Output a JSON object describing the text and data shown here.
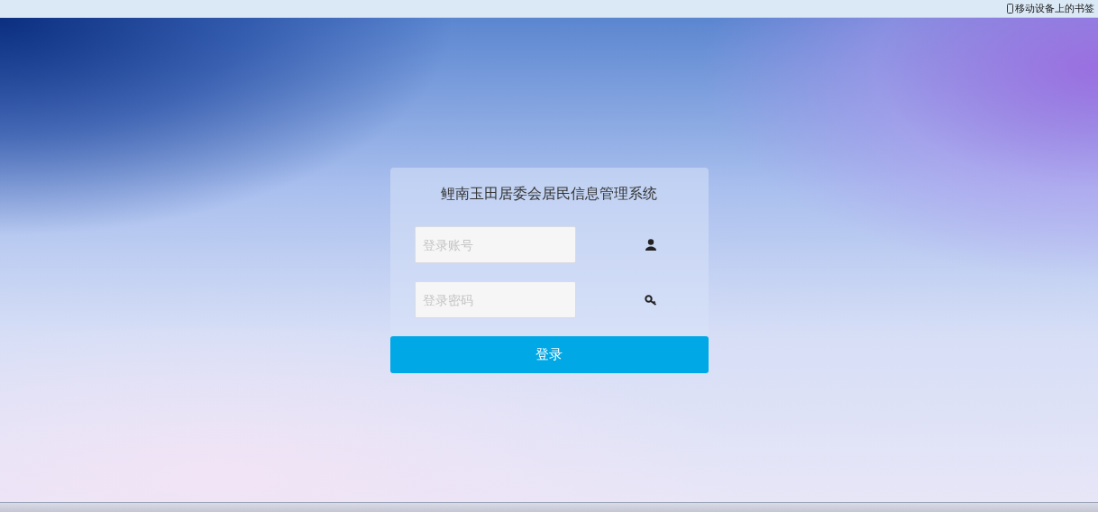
{
  "bookmarks_bar": {
    "mobile_bookmarks": "移动设备上的书签"
  },
  "login": {
    "title": "鲤南玉田居委会居民信息管理系统",
    "fields": [
      {
        "kind": "user",
        "placeholder": "登录账号"
      },
      {
        "kind": "password",
        "placeholder": "登录密码"
      }
    ],
    "submit": "登录"
  }
}
